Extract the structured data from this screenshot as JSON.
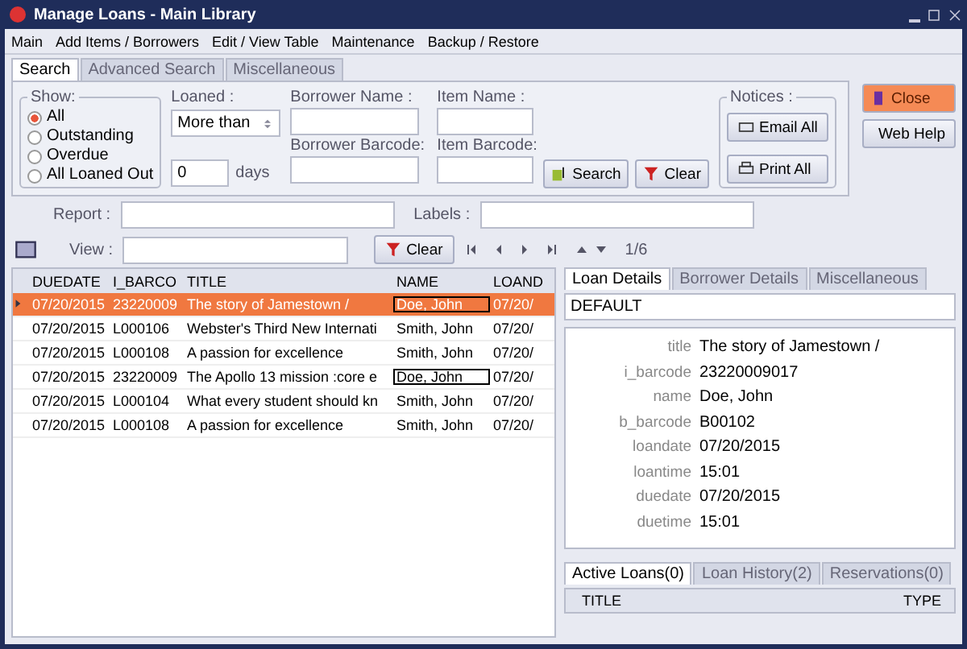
{
  "window": {
    "title": "Manage Loans - Main Library"
  },
  "menu": [
    "Main",
    "Add Items / Borrowers",
    "Edit / View Table",
    "Maintenance",
    "Backup / Restore"
  ],
  "search_tabs": [
    {
      "label": "Search",
      "selected": true
    },
    {
      "label": "Advanced Search",
      "selected": false
    },
    {
      "label": "Miscellaneous",
      "selected": false
    }
  ],
  "show": {
    "legend": "Show:",
    "options": [
      {
        "label": "All",
        "selected": true
      },
      {
        "label": "Outstanding",
        "selected": false
      },
      {
        "label": "Overdue",
        "selected": false
      },
      {
        "label": "All Loaned Out",
        "selected": false
      }
    ]
  },
  "loaned": {
    "label": "Loaned :",
    "value": "More than",
    "days_value": "0",
    "days_label": "days"
  },
  "fields": [
    {
      "label": "Borrower Name :"
    },
    {
      "label": "Item Name :"
    },
    {
      "label": "Borrower Barcode:"
    },
    {
      "label": "Item Barcode:"
    }
  ],
  "search_button": "Search",
  "clear_button": "Clear",
  "notices": {
    "legend": "Notices :",
    "buttons": [
      "Email All",
      "Print All"
    ]
  },
  "close_button": "Close",
  "help_button": "Web Help",
  "report_label": "Report :",
  "labels_label": "Labels :",
  "view_label": "View :",
  "view_clear": "Clear",
  "record_count": "1/6",
  "table": {
    "columns": [
      "DUEDATE",
      "I_BARCO",
      "TITLE",
      "NAME",
      "LOAND"
    ],
    "rows": [
      {
        "cells": [
          "07/20/2015",
          "23220009",
          "The story of Jamestown /",
          "Doe, John",
          "07/20/"
        ],
        "selected": true,
        "framed": true
      },
      {
        "cells": [
          "07/20/2015",
          "L000106",
          "Webster's Third New Internati",
          "Smith, John",
          "07/20/"
        ],
        "selected": false,
        "framed": false
      },
      {
        "cells": [
          "07/20/2015",
          "L000108",
          "A passion for excellence",
          "Smith, John",
          "07/20/"
        ],
        "selected": false,
        "framed": false
      },
      {
        "cells": [
          "07/20/2015",
          "23220009",
          "The Apollo 13 mission :core e",
          "Doe, John",
          "07/20/"
        ],
        "selected": false,
        "framed": true
      },
      {
        "cells": [
          "07/20/2015",
          "L000104",
          "What every student should kn",
          "Smith, John",
          "07/20/"
        ],
        "selected": false,
        "framed": false
      },
      {
        "cells": [
          "07/20/2015",
          "L000108",
          "A passion for excellence",
          "Smith, John",
          "07/20/"
        ],
        "selected": false,
        "framed": false
      }
    ]
  },
  "detail_tabs": [
    {
      "label": "Loan Details",
      "selected": true
    },
    {
      "label": "Borrower Details",
      "selected": false
    },
    {
      "label": "Miscellaneous",
      "selected": false
    }
  ],
  "detail_layout": "DEFAULT",
  "details": [
    {
      "key": "title",
      "value": "The story of Jamestown /"
    },
    {
      "key": "i_barcode",
      "value": "23220009017"
    },
    {
      "key": "name",
      "value": "Doe, John"
    },
    {
      "key": "b_barcode",
      "value": "B00102"
    },
    {
      "key": "loandate",
      "value": "07/20/2015"
    },
    {
      "key": "loantime",
      "value": "15:01"
    },
    {
      "key": "duedate",
      "value": "07/20/2015"
    },
    {
      "key": "duetime",
      "value": "15:01"
    }
  ],
  "loan_tabs": [
    {
      "label": "Active Loans(0)",
      "selected": true
    },
    {
      "label": "Loan History(2)",
      "selected": false
    },
    {
      "label": "Reservations(0)",
      "selected": false
    }
  ],
  "loan_columns": [
    "TITLE",
    "TYPE"
  ]
}
